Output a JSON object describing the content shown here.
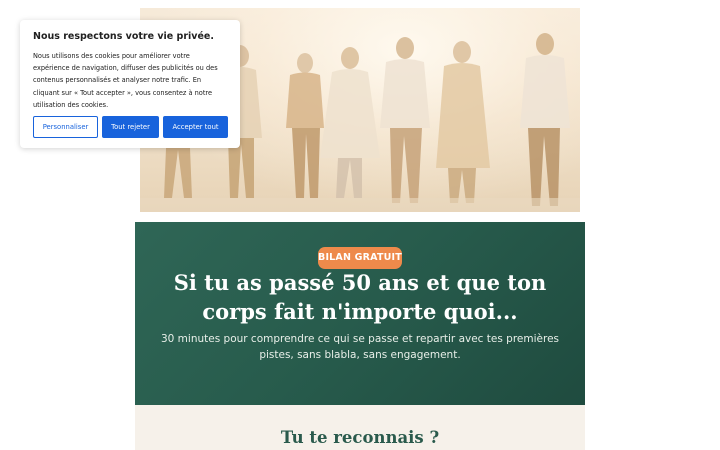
{
  "cookie_banner": {
    "title": "Nous respectons votre vie privée.",
    "body": "Nous utilisons des cookies pour améliorer votre expérience de navigation, diffuser des publicités ou des contenus personnalisés et analyser notre trafic. En cliquant sur « Tout accepter », vous consentez à notre utilisation des cookies.",
    "customize_label": "Personnaliser",
    "reject_label": "Tout rejeter",
    "accept_label": "Accepter tout",
    "accent_color": "#1863dc"
  },
  "hero": {
    "image_subject": "group of older adults walking"
  },
  "banner": {
    "badge": "BILAN GRATUIT",
    "headline": "Si tu as passé 50 ans et que ton corps fait n'importe quoi...",
    "subline": "30 minutes pour comprendre ce qui se passe et repartir avec tes premières pistes, sans blabla, sans engagement.",
    "background_color": "#275b4c",
    "badge_color": "#ee8a4b"
  },
  "section": {
    "title": "Tu te reconnais ?"
  }
}
